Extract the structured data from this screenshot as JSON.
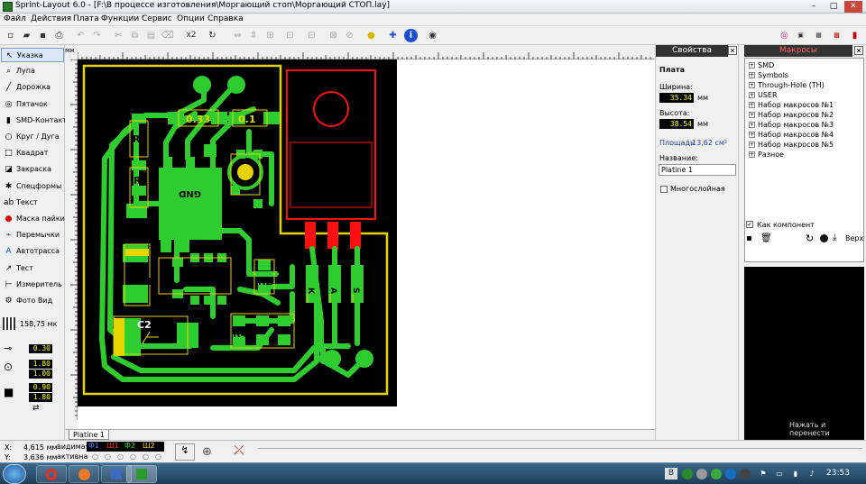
{
  "window": {
    "title": "Sprint-Layout 6.0 - [F:\\В процессе изготовления\\Моргающий стоп\\Моргающий СТОП.lay]"
  },
  "menu": [
    "Файл",
    "Действия",
    "Плата",
    "Функции",
    "Сервис",
    "Опции",
    "Справка"
  ],
  "toolbar": {
    "zoom_label": "x2"
  },
  "tools": [
    {
      "label": "Указка",
      "icon": "pointer-icon"
    },
    {
      "label": "Лупа",
      "icon": "magnifier-icon"
    },
    {
      "label": "Дорожка",
      "icon": "track-icon"
    },
    {
      "label": "Пятачок",
      "icon": "pad-icon"
    },
    {
      "label": "SMD-Контакт",
      "icon": "smd-pad-icon"
    },
    {
      "label": "Круг / Дуга",
      "icon": "circle-icon"
    },
    {
      "label": "Квадрат",
      "icon": "square-icon"
    },
    {
      "label": "Закраска",
      "icon": "fill-icon"
    },
    {
      "label": "Спецформы",
      "icon": "special-shapes-icon"
    },
    {
      "label": "Текст",
      "icon": "text-icon"
    },
    {
      "label": "Маска пайки",
      "icon": "solder-mask-icon"
    },
    {
      "label": "Перемычки",
      "icon": "jumper-icon"
    },
    {
      "label": "Автотрасса",
      "icon": "autoroute-icon"
    },
    {
      "label": "Тест",
      "icon": "test-icon"
    },
    {
      "label": "Измеритель",
      "icon": "measure-icon"
    },
    {
      "label": "Фото Вид",
      "icon": "photo-view-icon"
    }
  ],
  "grid": {
    "label": "158,75 мк"
  },
  "track_settings": {
    "track_width": "0.30",
    "pad_outer": "1.80",
    "pad_inner": "1.00",
    "smd_w": "0.90",
    "smd_h": "1.80"
  },
  "ruler": {
    "unit": "мм"
  },
  "board_labels": {
    "r_top_left": "0.33",
    "r_top_right": "0.1",
    "r3": "R3",
    "r1": "R1",
    "gnd": "GND",
    "r2": "R2",
    "c1": "C1",
    "c2": "C2",
    "r4": "R4",
    "pin_k": "К",
    "pin_a": "А",
    "pin_s": "S"
  },
  "tab": {
    "label": "Platine 1"
  },
  "properties": {
    "header": "Свойства",
    "section": "Плата",
    "width_label": "Ширина:",
    "width_value": "35.34",
    "width_unit": "мм",
    "height_label": "Высота:",
    "height_value": "38.54",
    "height_unit": "мм",
    "area_label": "Площадь",
    "area_value": "13,62 см²",
    "name_label": "Название:",
    "name_value": "Platine 1",
    "multilayer_label": "Многослойная"
  },
  "macros": {
    "header": "Макросы",
    "items": [
      "SMD",
      "Symbols",
      "Through-Hole (TH)",
      "USER",
      "Набор макросов №1",
      "Набор макросов №2",
      "Набор макросов №3",
      "Набор макросов №4",
      "Набор макросов №5",
      "Разное"
    ],
    "as_component_label": "Как компонент",
    "top_label": "Верх",
    "drag_hint": "Нажать и перенести"
  },
  "status": {
    "x_label": "X:",
    "x_value": "4,615 мм",
    "y_label": "Y:",
    "y_value": "3,636 мм",
    "visible_label": "видимая",
    "active_label": "активна",
    "layers": [
      {
        "name": "Ф1",
        "color": "#4a7dff"
      },
      {
        "name": "Ш1",
        "color": "#ff3030"
      },
      {
        "name": "Ф2",
        "color": "#30d030"
      },
      {
        "name": "Ш2",
        "color": "#e0d000"
      }
    ]
  },
  "taskbar": {
    "lang": "В",
    "time": "23:53"
  },
  "colors": {
    "board_bg": "#000000",
    "copper_top": "#2ecc2e",
    "outline": "#e6d500",
    "silk_red": "#ff1010",
    "panel_header": "#333333"
  }
}
